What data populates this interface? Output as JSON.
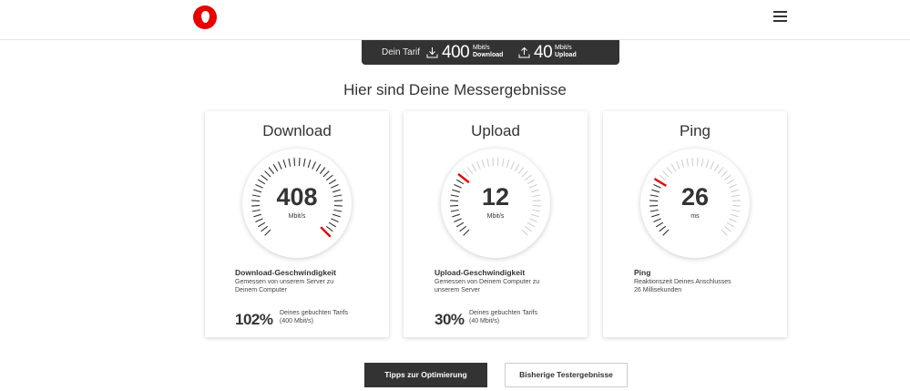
{
  "header": {
    "logo": "vodafone-logo",
    "menu_icon": "hamburger-menu-icon"
  },
  "tarif": {
    "label": "Dein Tarif",
    "download_value": "400",
    "download_unit": "Mbit/s",
    "download_label": "Download",
    "upload_value": "40",
    "upload_unit": "Mbit/s",
    "upload_label": "Upload",
    "download_icon": "download-icon",
    "upload_icon": "upload-icon"
  },
  "results_title": "Hier sind Deine Messergebnisse",
  "cards": [
    {
      "title": "Download",
      "value": "408",
      "unit": "Mbit/s",
      "needle_fraction": 0.99,
      "subtitle": "Download-Geschwindigkeit",
      "desc_line1": "Gemessen von unserem Server zu",
      "desc_line2": "Deinem Computer",
      "percent": "102%",
      "percent_line1": "Deines gebuchten Tarifs",
      "percent_line2": "(400 Mbit/s)"
    },
    {
      "title": "Upload",
      "value": "12",
      "unit": "Mbit/s",
      "needle_fraction": 0.3,
      "subtitle": "Upload-Geschwindigkeit",
      "desc_line1": "Gemessen von Deinem Computer zu",
      "desc_line2": "unserem Server",
      "percent": "30%",
      "percent_line1": "Deines gebuchten Tarifs",
      "percent_line2": "(40 Mbit/s)"
    },
    {
      "title": "Ping",
      "value": "26",
      "unit": "ms",
      "needle_fraction": 0.28,
      "subtitle": "Ping",
      "desc_line1": "Reaktionszeit Deines Anschlusses",
      "desc_line2": "26 Millisekunden"
    }
  ],
  "buttons": {
    "tips": "Tipps zur Optimierung",
    "history": "Bisherige Testergebnisse"
  },
  "colors": {
    "accent": "#e60000",
    "dark": "#333333",
    "tick_light": "#d0d0d0"
  }
}
